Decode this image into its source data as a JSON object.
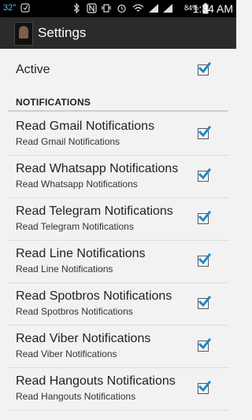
{
  "status_bar": {
    "temperature": "32°",
    "battery_percent": "84%",
    "time": "1:34 AM",
    "accent_color": "#4fc3f7"
  },
  "action_bar": {
    "title": "Settings"
  },
  "active": {
    "label": "Active",
    "checked": true
  },
  "section": {
    "header": "NOTIFICATIONS"
  },
  "preferences": [
    {
      "title": "Read Gmail Notifications",
      "summary": "Read Gmail Notifications",
      "checked": true
    },
    {
      "title": "Read Whatsapp Notifications",
      "summary": "Read Whatsapp Notifications",
      "checked": true
    },
    {
      "title": "Read Telegram Notifications",
      "summary": "Read Telegram Notifications",
      "checked": true
    },
    {
      "title": "Read Line Notifications",
      "summary": "Read Line Notifications",
      "checked": true
    },
    {
      "title": "Read Spotbros Notifications",
      "summary": "Read Spotbros Notifications",
      "checked": true
    },
    {
      "title": "Read Viber Notifications",
      "summary": "Read Viber Notifications",
      "checked": true
    },
    {
      "title": "Read Hangouts Notifications",
      "summary": "Read Hangouts Notifications",
      "checked": true
    }
  ],
  "colors": {
    "check_mark": "#1e88c8",
    "background": "#f2f2f2",
    "action_bar": "#2b2b2b"
  }
}
